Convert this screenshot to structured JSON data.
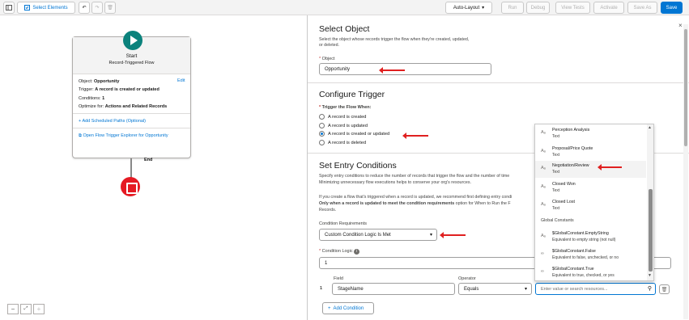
{
  "toolbar": {
    "select_elements": "Select Elements",
    "auto_layout": "Auto-Layout",
    "run": "Run",
    "debug": "Debug",
    "view_tests": "View Tests",
    "activate": "Activate",
    "save_as": "Save As",
    "save": "Save"
  },
  "start": {
    "title": "Start",
    "subtitle": "Record-Triggered Flow",
    "object_label": "Object:",
    "object_value": "Opportunity",
    "edit": "Edit",
    "trigger_label": "Trigger:",
    "trigger_value": "A record is created or updated",
    "conditions_label": "Conditions:",
    "conditions_value": "1",
    "optimize_label": "Optimize for:",
    "optimize_value": "Actions and Related Records",
    "add_paths": "Add Scheduled Paths (Optional)",
    "open_explorer": "Open Flow Trigger Explorer for Opportunity"
  },
  "end_label": "End",
  "select_object": {
    "title": "Select Object",
    "desc_line1": "Select the object whose records trigger the flow when they're created, updated,",
    "desc_line2": "or deleted.",
    "object_label": "Object",
    "object_value": "Opportunity"
  },
  "configure_trigger": {
    "title": "Configure Trigger",
    "label": "Trigger the Flow When:",
    "options": [
      "A record is created",
      "A record is updated",
      "A record is created or updated",
      "A record is deleted"
    ],
    "selected": "A record is created or updated"
  },
  "entry_conditions": {
    "title": "Set Entry Conditions",
    "desc1": "Specify entry conditions to reduce the number of records that trigger the flow and the number of time",
    "desc2": "Minimizing unnecessary flow executions helps to conserve your org's resources.",
    "desc3": "If you create a flow that's triggered when a record is updated, we recommend first defining entry condi",
    "desc4_bold": "Only when a record is updated to meet the condition requirements",
    "desc4_rest": " option for When to Run the F",
    "desc5": "Records.",
    "requirements_label": "Condition Requirements",
    "requirements_value": "Custom Condition Logic Is Met",
    "logic_label": "Condition Logic",
    "logic_value": "1",
    "field_header": "Field",
    "operator_header": "Operator",
    "row_number": "1",
    "field_value": "StageName",
    "operator_value": "Equals",
    "value_placeholder": "Enter value or search resources...",
    "add_condition": "Add Condition"
  },
  "dropdown": {
    "items": [
      {
        "icon": "Aₐ",
        "name": "Perception Analysis",
        "type": "Text"
      },
      {
        "icon": "Aₐ",
        "name": "Proposal/Price Quote",
        "type": "Text"
      },
      {
        "icon": "Aₐ",
        "name": "Negotiation/Review",
        "type": "Text"
      },
      {
        "icon": "Aₐ",
        "name": "Closed Won",
        "type": "Text"
      },
      {
        "icon": "Aₐ",
        "name": "Closed Lost",
        "type": "Text"
      }
    ],
    "group_label": "Global Constants",
    "constants": [
      {
        "icon": "Aₐ",
        "name": "$GlobalConstant.EmptyString",
        "desc": "Equivalent to empty string (not null)"
      },
      {
        "icon": "∞",
        "name": "$GlobalConstant.False",
        "desc": "Equivalent to false, unchecked, or no"
      },
      {
        "icon": "∞",
        "name": "$GlobalConstant.True",
        "desc": "Equivalent to true, checked, or yes"
      }
    ]
  },
  "colors": {
    "brand": "#0176d3",
    "start_teal": "#0b827c",
    "end_red": "#e51a23",
    "annotation_red": "#e02020"
  }
}
